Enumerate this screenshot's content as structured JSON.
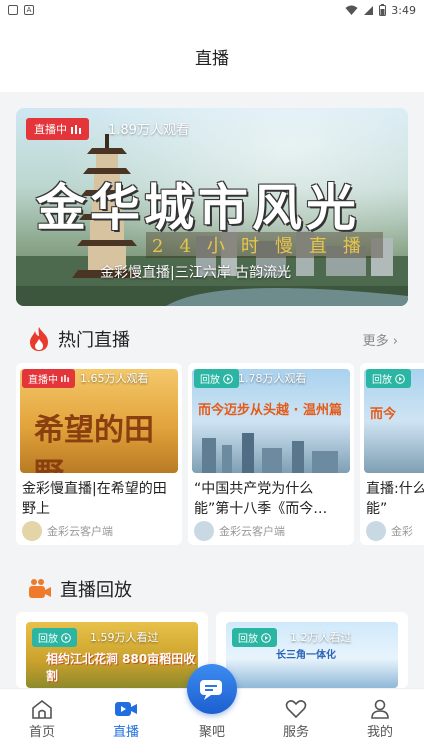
{
  "status_bar": {
    "time": "3:49"
  },
  "header": {
    "title": "直播"
  },
  "hero": {
    "badge": "直播中",
    "viewers": "1.89万人观看",
    "big_title": "金华城市风光",
    "sub_title": "24小时慢直播",
    "caption": "金彩慢直播|三江六岸 古韵流光"
  },
  "hot_live": {
    "title": "热门直播",
    "more": "更多",
    "cards": [
      {
        "tag": "直播中",
        "tag_type": "live",
        "count": "1.65万人观看",
        "title": "金彩慢直播|在希望的田野上",
        "source": "金彩云客户端",
        "thumb_text": "希望的田野"
      },
      {
        "tag": "回放",
        "tag_type": "replay",
        "count": "1.78万人观看",
        "title": "“中国共产党为什么能”第十八季《而今…",
        "source": "金彩云客户端",
        "thumb_text": "而今迈步从头越 · 温州篇"
      },
      {
        "tag": "回放",
        "tag_type": "replay",
        "count": "",
        "title": "直播:什么能”",
        "source": "金彩",
        "thumb_text": "而今"
      }
    ]
  },
  "replay": {
    "title": "直播回放",
    "cards": [
      {
        "tag": "回放",
        "count": "1.59万人看过",
        "thumb_text": "相约江北花涧 880亩稻田收割"
      },
      {
        "tag": "回放",
        "count": "1.2万人看过",
        "thumb_text": "长三角一体化"
      }
    ]
  },
  "nav": {
    "items": [
      {
        "label": "首页"
      },
      {
        "label": "直播"
      },
      {
        "label": "聚吧"
      },
      {
        "label": "服务"
      },
      {
        "label": "我的"
      }
    ]
  },
  "colors": {
    "accent": "#1f6fe0",
    "live_red": "#e4353a",
    "replay_teal": "#2bb6a3"
  }
}
